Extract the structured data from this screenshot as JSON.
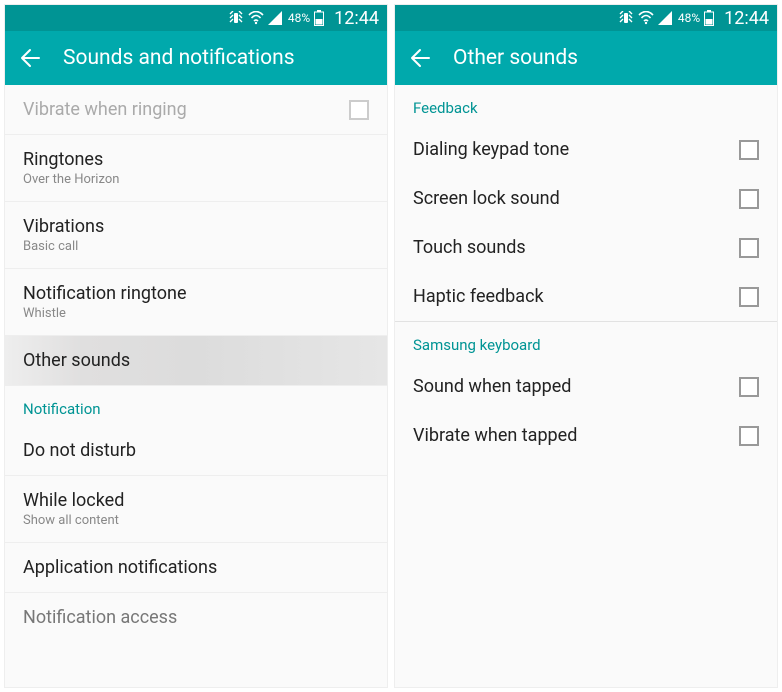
{
  "status": {
    "battery_pct": "48%",
    "time": "12:44"
  },
  "left": {
    "title": "Sounds and notifications",
    "items": [
      {
        "label": "Vibrate when ringing",
        "sub": null,
        "checkbox": true,
        "disabled": true
      },
      {
        "label": "Ringtones",
        "sub": "Over the Horizon",
        "checkbox": false
      },
      {
        "label": "Vibrations",
        "sub": "Basic call",
        "checkbox": false
      },
      {
        "label": "Notification ringtone",
        "sub": "Whistle",
        "checkbox": false
      },
      {
        "label": "Other sounds",
        "sub": null,
        "checkbox": false,
        "highlighted": true
      }
    ],
    "section": "Notification",
    "items2": [
      {
        "label": "Do not disturb",
        "sub": null
      },
      {
        "label": "While locked",
        "sub": "Show all content"
      },
      {
        "label": "Application notifications",
        "sub": null
      },
      {
        "label": "Notification access",
        "sub": null
      }
    ]
  },
  "right": {
    "title": "Other sounds",
    "section1": "Feedback",
    "items1": [
      {
        "label": "Dialing keypad tone"
      },
      {
        "label": "Screen lock sound"
      },
      {
        "label": "Touch sounds"
      },
      {
        "label": "Haptic feedback"
      }
    ],
    "section2": "Samsung keyboard",
    "items2": [
      {
        "label": "Sound when tapped"
      },
      {
        "label": "Vibrate when tapped"
      }
    ]
  }
}
